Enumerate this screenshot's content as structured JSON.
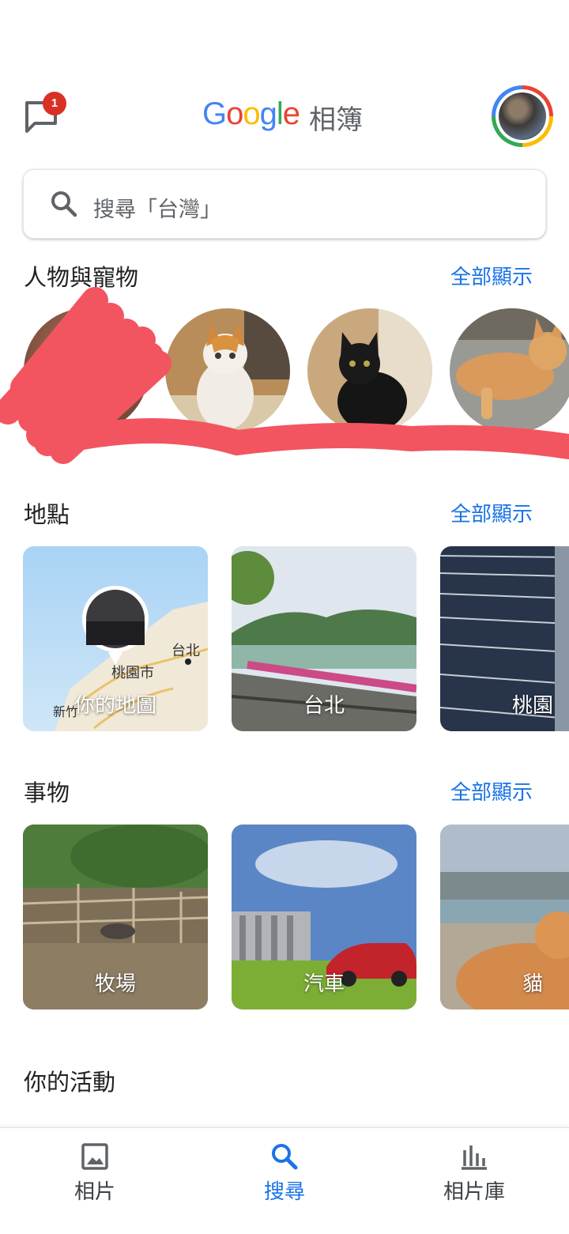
{
  "header": {
    "chat_badge": "1",
    "logo_letters": [
      "G",
      "o",
      "o",
      "g",
      "l",
      "e"
    ],
    "logo_colors": [
      "#4285f4",
      "#ea4335",
      "#fbbc05",
      "#4285f4",
      "#34a853",
      "#ea4335"
    ],
    "title_suffix": "相簿"
  },
  "search": {
    "placeholder": "搜尋「台灣」"
  },
  "people_section": {
    "title": "人物與寵物",
    "show_all": "全部顯示"
  },
  "places_section": {
    "title": "地點",
    "show_all": "全部顯示",
    "cards": [
      {
        "label": "你的地圖",
        "map_pin": "桃園市",
        "map_city": "台北",
        "map_small": "新竹"
      },
      {
        "label": "台北"
      },
      {
        "label": "桃園"
      }
    ]
  },
  "things_section": {
    "title": "事物",
    "show_all": "全部顯示",
    "cards": [
      {
        "label": "牧場"
      },
      {
        "label": "汽車"
      },
      {
        "label": "貓"
      }
    ]
  },
  "activity_section": {
    "title": "你的活動"
  },
  "bottom_nav": {
    "items": [
      {
        "label": "相片",
        "icon": "photo-icon"
      },
      {
        "label": "搜尋",
        "icon": "search-icon"
      },
      {
        "label": "相片庫",
        "icon": "library-icon"
      }
    ],
    "active_color": "#1a73e8"
  }
}
